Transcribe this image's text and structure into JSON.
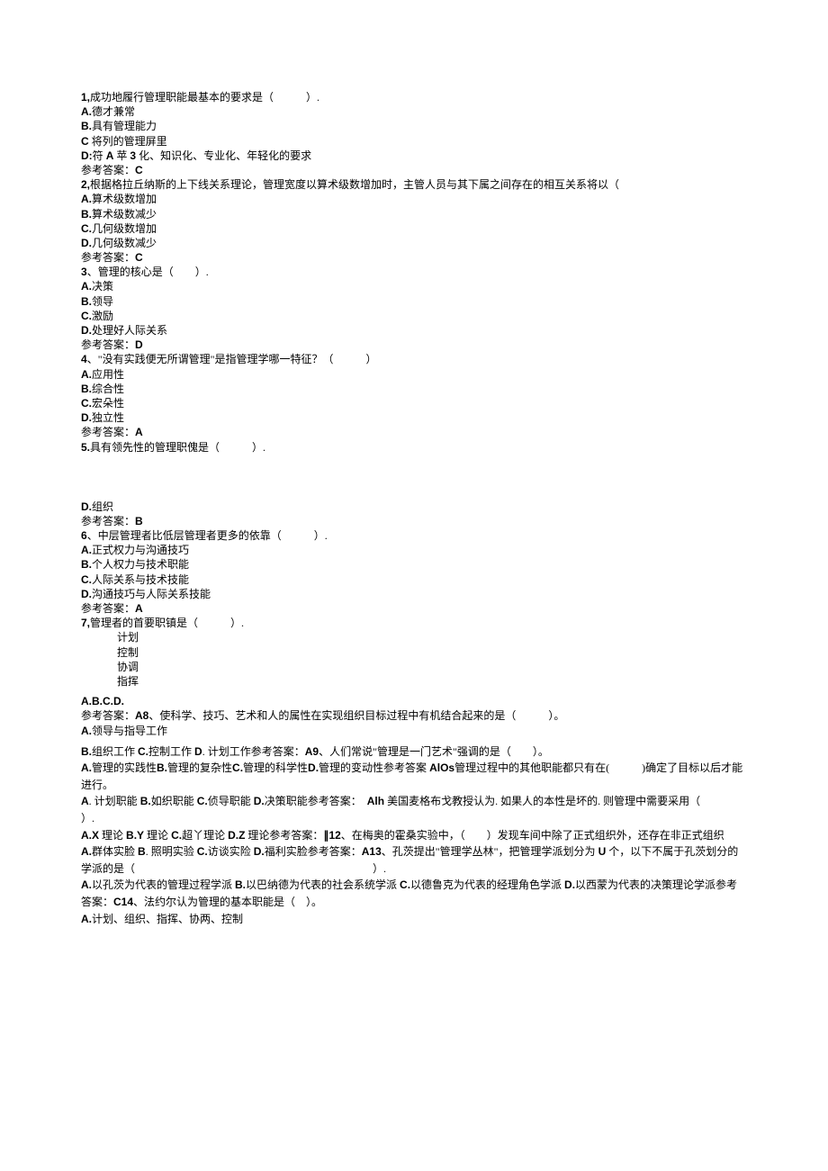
{
  "doc": {
    "lines": [
      {
        "segs": [
          {
            "t": "1,",
            "b": true
          },
          {
            "t": "成功地履行管理职能最基本的要求是（　　　）."
          }
        ]
      },
      {
        "segs": [
          {
            "t": "A.",
            "b": true
          },
          {
            "t": "德才兼常"
          }
        ]
      },
      {
        "segs": [
          {
            "t": "B.",
            "b": true
          },
          {
            "t": "具有管理能力"
          }
        ]
      },
      {
        "segs": [
          {
            "t": "C",
            "b": true
          },
          {
            "t": " 将列的管理屏里"
          }
        ]
      },
      {
        "segs": [
          {
            "t": "D:",
            "b": true
          },
          {
            "t": "符 "
          },
          {
            "t": "A",
            "b": true
          },
          {
            "t": " 苹 "
          },
          {
            "t": "3",
            "b": true
          },
          {
            "t": " 化、知识化、专业化、年轻化的要求"
          }
        ]
      },
      {
        "segs": [
          {
            "t": "参考答案："
          },
          {
            "t": "C",
            "b": true
          }
        ]
      },
      {
        "segs": [
          {
            "t": "2,",
            "b": true
          },
          {
            "t": "根据格拉丘纳斯的上下线关系理论，管理宽度以算术级数增加时，主管人员与其下属之间存在的相互关系将以（"
          }
        ]
      },
      {
        "segs": [
          {
            "t": "A.",
            "b": true
          },
          {
            "t": "算术级数增加"
          }
        ]
      },
      {
        "segs": [
          {
            "t": "B.",
            "b": true
          },
          {
            "t": "算术级数减少"
          }
        ]
      },
      {
        "segs": [
          {
            "t": "C.",
            "b": true
          },
          {
            "t": "几何级数增加"
          }
        ]
      },
      {
        "segs": [
          {
            "t": "D.",
            "b": true
          },
          {
            "t": "几何级数减少"
          }
        ]
      },
      {
        "segs": [
          {
            "t": "参考答案："
          },
          {
            "t": "C",
            "b": true
          }
        ]
      },
      {
        "segs": [
          {
            "t": "3",
            "b": true
          },
          {
            "t": "、管理的核心是（　　）."
          }
        ]
      },
      {
        "segs": [
          {
            "t": "A.",
            "b": true
          },
          {
            "t": "决策"
          }
        ]
      },
      {
        "segs": [
          {
            "t": "B.",
            "b": true
          },
          {
            "t": "领导"
          }
        ]
      },
      {
        "segs": [
          {
            "t": "C.",
            "b": true
          },
          {
            "t": "激励"
          }
        ]
      },
      {
        "segs": [
          {
            "t": "D.",
            "b": true
          },
          {
            "t": "处理好人际关系"
          }
        ]
      },
      {
        "segs": [
          {
            "t": "参考答案："
          },
          {
            "t": "D",
            "b": true
          }
        ]
      },
      {
        "segs": [
          {
            "t": "4",
            "b": true
          },
          {
            "t": "、\"没有实践便无所谓管理\"是指管理学哪一特征？（　　　）"
          }
        ]
      },
      {
        "segs": [
          {
            "t": "A.",
            "b": true
          },
          {
            "t": "应用性"
          }
        ]
      },
      {
        "segs": [
          {
            "t": "B.",
            "b": true
          },
          {
            "t": "综合性"
          }
        ]
      },
      {
        "segs": [
          {
            "t": "C.",
            "b": true
          },
          {
            "t": "宏朵性"
          }
        ]
      },
      {
        "segs": [
          {
            "t": "D.",
            "b": true
          },
          {
            "t": "独立性"
          }
        ]
      },
      {
        "segs": [
          {
            "t": "参考答案："
          },
          {
            "t": "A",
            "b": true
          }
        ]
      },
      {
        "segs": [
          {
            "t": "5.",
            "b": true
          },
          {
            "t": "具有领先性的管理职傀是（　　　）."
          }
        ]
      }
    ],
    "spacer": true,
    "lines2": [
      {
        "segs": [
          {
            "t": "D.",
            "b": true
          },
          {
            "t": "组织"
          }
        ]
      },
      {
        "segs": [
          {
            "t": "参考答案："
          },
          {
            "t": "B",
            "b": true
          }
        ]
      },
      {
        "segs": [
          {
            "t": "6",
            "b": true
          },
          {
            "t": "、中层管理者比低层管理者更多的依靠（　　　）."
          }
        ]
      },
      {
        "segs": [
          {
            "t": "A.",
            "b": true
          },
          {
            "t": "正式权力与沟通技巧"
          }
        ]
      },
      {
        "segs": [
          {
            "t": "B.",
            "b": true
          },
          {
            "t": "个人权力与技术职能"
          }
        ]
      },
      {
        "segs": [
          {
            "t": "C.",
            "b": true
          },
          {
            "t": "人际关系与技术技能"
          }
        ]
      },
      {
        "segs": [
          {
            "t": "D.",
            "b": true
          },
          {
            "t": "沟通技巧与人际关系技能"
          }
        ]
      },
      {
        "segs": [
          {
            "t": "参考答案："
          },
          {
            "t": "A",
            "b": true
          }
        ]
      },
      {
        "segs": [
          {
            "t": "7,",
            "b": true
          },
          {
            "t": "管理者的首要职镇是（　　　）."
          }
        ]
      }
    ],
    "col": [
      "计划",
      "控制",
      "协调",
      "指挥"
    ],
    "lines3": [
      {
        "segs": [
          {
            "t": "A.B.C.D.",
            "b": true
          }
        ]
      },
      {
        "segs": [
          {
            "t": "参考答案："
          },
          {
            "t": "A8",
            "b": true
          },
          {
            "t": "、使科学、技巧、艺术和人的属性在实现组织目标过程中有机结合起来的是（　　　）。"
          }
        ]
      },
      {
        "segs": [
          {
            "t": "A.",
            "b": true
          },
          {
            "t": "领导与指导工作"
          }
        ]
      }
    ],
    "lines4": [
      {
        "segs": [
          {
            "t": "B.",
            "b": true
          },
          {
            "t": "组织工作 "
          },
          {
            "t": "C.",
            "b": true
          },
          {
            "t": "控制工作 "
          },
          {
            "t": "D",
            "b": true
          },
          {
            "t": ". 计划工作参考答案："
          },
          {
            "t": "A9",
            "b": true
          },
          {
            "t": "、人们常说\"管理是一门艺术\"强调的是（　　）。"
          }
        ]
      },
      {
        "segs": [
          {
            "t": "A.",
            "b": true
          },
          {
            "t": "管理的实践性"
          },
          {
            "t": "B.",
            "b": true
          },
          {
            "t": "管理的复杂性"
          },
          {
            "t": "C.",
            "b": true
          },
          {
            "t": "管理的科学性"
          },
          {
            "t": "D.",
            "b": true
          },
          {
            "t": "管理的变动性参考答案 "
          },
          {
            "t": "AlOs",
            "b": true
          },
          {
            "t": "管理过程中的其他职能都只有在(　　　)确定了目标以后才能进行。"
          }
        ]
      },
      {
        "segs": [
          {
            "t": "A",
            "b": true
          },
          {
            "t": ". 计划职能 "
          },
          {
            "t": "B.",
            "b": true
          },
          {
            "t": "如织职能 "
          },
          {
            "t": "C.",
            "b": true
          },
          {
            "t": "侦导职能 "
          },
          {
            "t": "D.",
            "b": true
          },
          {
            "t": "决策职能参考答案：  "
          },
          {
            "t": "Alh",
            "b": true
          },
          {
            "t": " 美国麦格布戈教授认为. 如果人的本性是坏的. 则管理中需要采用（　　　                                                      ）."
          }
        ]
      },
      {
        "segs": [
          {
            "t": "A.X",
            "b": true
          },
          {
            "t": " 理论 "
          },
          {
            "t": "B.Y",
            "b": true
          },
          {
            "t": " 理论 "
          },
          {
            "t": "C.",
            "b": true
          },
          {
            "t": "超丫理论 "
          },
          {
            "t": "D.Z",
            "b": true
          },
          {
            "t": " 理论参考答案："
          },
          {
            "t": "∥12",
            "b": true
          },
          {
            "t": "、在梅奥的霍桑实验中，（　　）发现车间中除了正式组织外，还存在非正式组织"
          }
        ]
      },
      {
        "segs": [
          {
            "t": "A.",
            "b": true
          },
          {
            "t": "群体实脸 "
          },
          {
            "t": "B",
            "b": true
          },
          {
            "t": ". 照明实验 "
          },
          {
            "t": "C.",
            "b": true
          },
          {
            "t": "访谈实险 "
          },
          {
            "t": "D.",
            "b": true
          },
          {
            "t": "福利实脸参考答案："
          },
          {
            "t": "A13",
            "b": true
          },
          {
            "t": "、孔茨提出\"管理学丛林\"，把管理学派划分为 "
          },
          {
            "t": "U",
            "b": true
          },
          {
            "t": " 个，以下不属于孔茨划分的学派的是（　　　　　　　　　　　　　　　　　　　　　　）."
          }
        ]
      },
      {
        "segs": [
          {
            "t": "A.",
            "b": true
          },
          {
            "t": "以孔茨为代表的管理过程学派 "
          },
          {
            "t": "B.",
            "b": true
          },
          {
            "t": "以巴纳德为代表的社会系统学派 "
          },
          {
            "t": "C.",
            "b": true
          },
          {
            "t": "以德鲁克为代表的经理角色学派 "
          },
          {
            "t": "D.",
            "b": true
          },
          {
            "t": "以西蒙为代表的决策理论学派参考答案："
          },
          {
            "t": "C14",
            "b": true
          },
          {
            "t": "、法约尔认为管理的基本职能是（　）。"
          }
        ]
      },
      {
        "segs": [
          {
            "t": "A.",
            "b": true
          },
          {
            "t": "计划、组织、指挥、协两、控制"
          }
        ]
      }
    ]
  }
}
